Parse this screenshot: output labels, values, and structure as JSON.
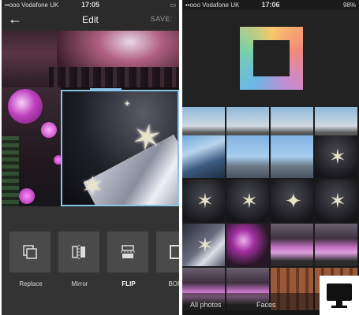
{
  "left_screen": {
    "status": {
      "carrier": "••ooo Vodafone UK",
      "time": "17:05",
      "battery": "▭"
    },
    "header": {
      "back_icon": "back-arrow-icon",
      "title": "Edit",
      "save_label": "SAVE"
    },
    "tools": [
      {
        "label": "Replace",
        "icon": "replace-icon"
      },
      {
        "label": "Mirror",
        "icon": "mirror-icon"
      },
      {
        "label": "FLIP",
        "icon": "flip-icon"
      },
      {
        "label": "BORD",
        "icon": "border-icon"
      }
    ]
  },
  "right_screen": {
    "status": {
      "carrier": "••ooo Vodafone UK",
      "time": "17:06",
      "battery": "98%"
    },
    "logo": "layout-logo-icon",
    "tabs": {
      "all_photos": "All photos",
      "faces": "Faces"
    }
  },
  "colors": {
    "selection": "#8ac3e6",
    "toolbar": "#333333",
    "tile": "#4a4a4a"
  }
}
